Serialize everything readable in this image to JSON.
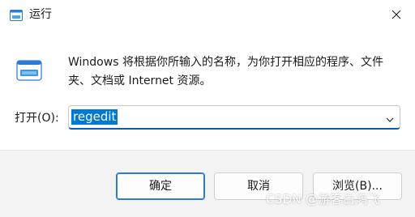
{
  "window": {
    "title": "运行",
    "title_icon": "run-icon",
    "close_icon": "close-icon"
  },
  "content": {
    "icon": "run-dialog-icon",
    "description": "Windows 将根据你所输入的名称，为你打开相应的程序、文件夹、文档或 Internet 资源。",
    "open_label": "打开(O):",
    "input_value": "regedit",
    "dropdown_icon": "chevron-down-icon"
  },
  "buttons": {
    "ok": "确定",
    "cancel": "取消",
    "browse": "浏览(B)..."
  },
  "watermark": "CSDN @游客白鸿飞",
  "colors": {
    "accent": "#0078d4",
    "footer_bg": "#f3f3f3"
  }
}
